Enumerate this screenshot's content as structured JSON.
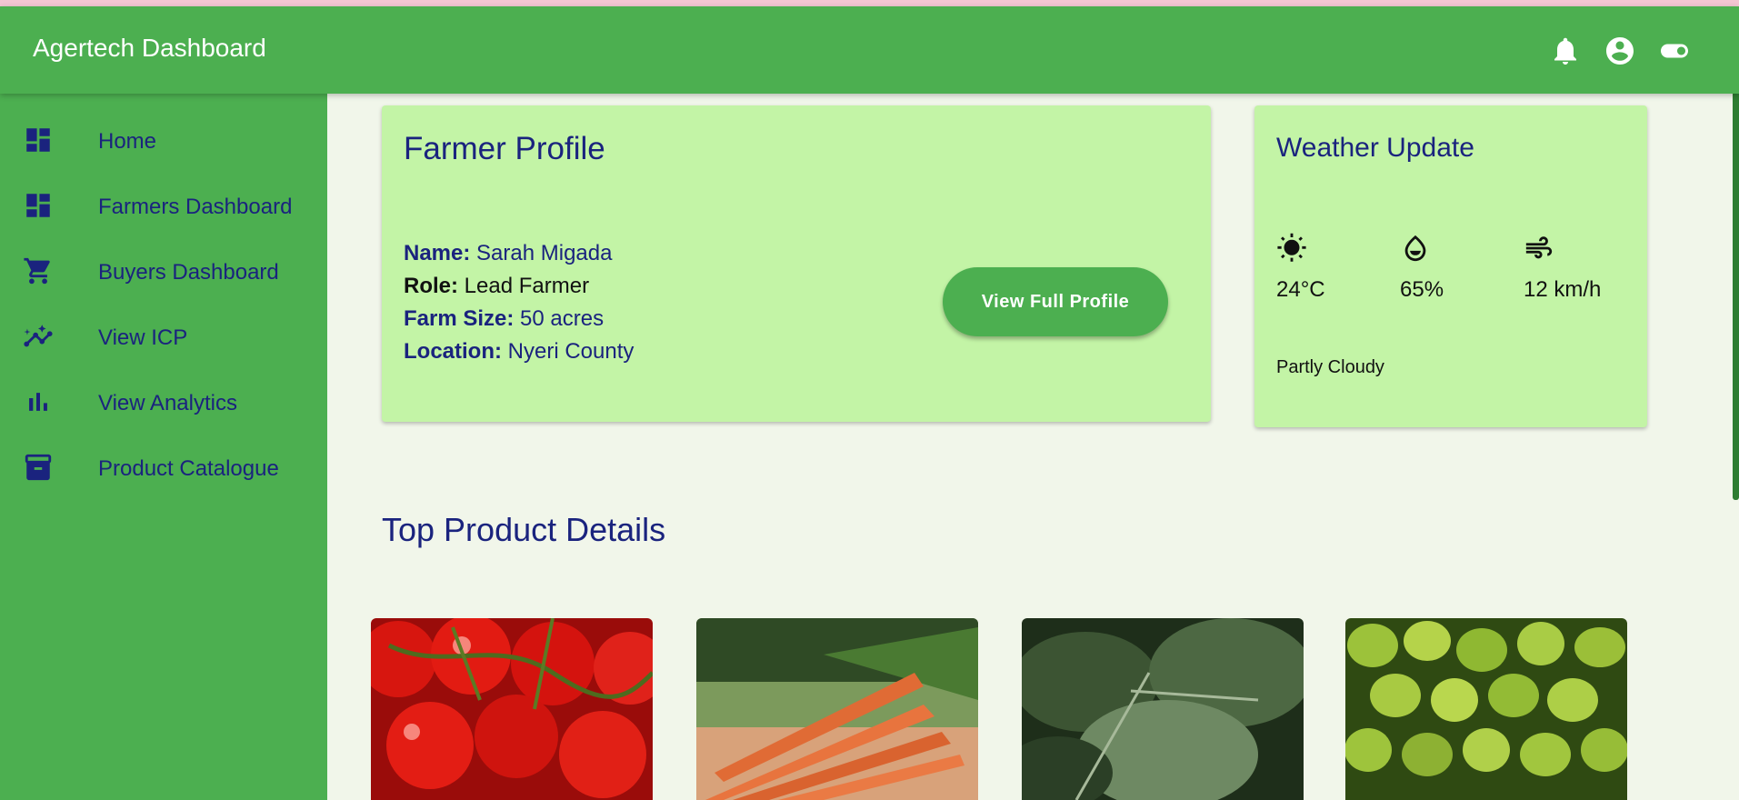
{
  "app_bar": {
    "title": "Agertech Dashboard",
    "icons": [
      "notifications-icon",
      "account-circle-icon",
      "toggle-icon"
    ]
  },
  "sidebar": {
    "items": [
      {
        "label": "Home",
        "icon": "dashboard-icon"
      },
      {
        "label": "Farmers Dashboard",
        "icon": "dashboard-icon"
      },
      {
        "label": "Buyers Dashboard",
        "icon": "shopping-cart-icon"
      },
      {
        "label": "View ICP",
        "icon": "insights-icon"
      },
      {
        "label": "View Analytics",
        "icon": "bar-chart-icon"
      },
      {
        "label": "Product Catalogue",
        "icon": "archive-icon"
      }
    ]
  },
  "profile": {
    "title": "Farmer Profile",
    "name_label": "Name:",
    "name": "Sarah Migada",
    "role_label": "Role:",
    "role": "Lead Farmer",
    "farm_size_label": "Farm Size:",
    "farm_size": "50 acres",
    "location_label": "Location:",
    "location": "Nyeri County",
    "button_label": "View Full Profile"
  },
  "weather": {
    "title": "Weather Update",
    "temperature": "24°C",
    "humidity": "65%",
    "wind": "12 km/h",
    "condition": "Partly Cloudy",
    "icons": [
      "sun-icon",
      "water-drop-icon",
      "wind-icon"
    ]
  },
  "products": {
    "title": "Top Product Details",
    "items": [
      {
        "image": "tomatoes-image"
      },
      {
        "image": "carrots-image"
      },
      {
        "image": "spinach-image"
      },
      {
        "image": "avocados-image"
      }
    ]
  },
  "colors": {
    "primary_green": "#4caf50",
    "card_green": "#c3f4a6",
    "text_navy": "#1a237e",
    "background": "#f1f6ea"
  }
}
